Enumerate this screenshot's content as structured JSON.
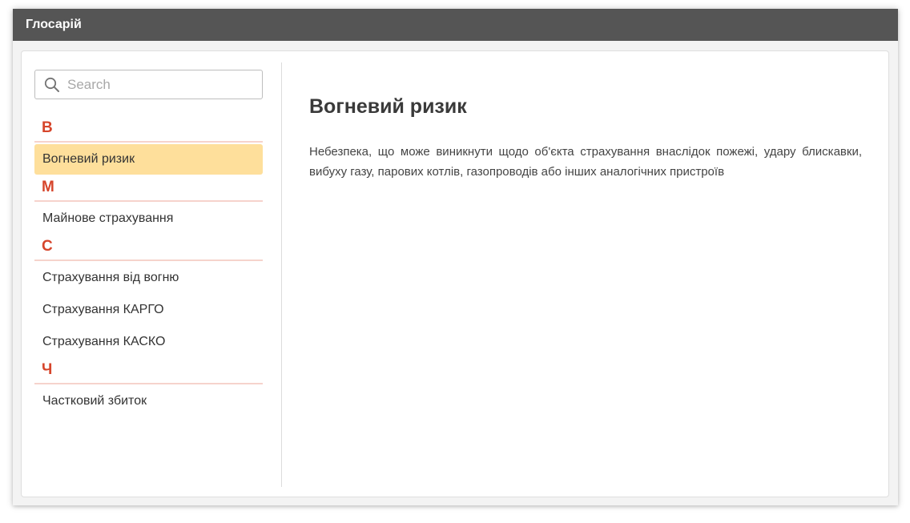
{
  "window": {
    "title": "Глосарій"
  },
  "search": {
    "placeholder": "Search",
    "value": ""
  },
  "glossary": {
    "groups": [
      {
        "letter": "В",
        "items": [
          "Вогневий ризик"
        ]
      },
      {
        "letter": "М",
        "items": [
          "Майнове страхування"
        ]
      },
      {
        "letter": "С",
        "items": [
          "Страхування від вогню",
          "Страхування КАРГО",
          "Страхування КАСКО"
        ]
      },
      {
        "letter": "Ч",
        "items": [
          "Частковий збиток"
        ]
      }
    ],
    "selected": "Вогневий ризик"
  },
  "detail": {
    "title": "Вогневий ризик",
    "text": "Небезпека, що може виникнути щодо об'єкта страхування внаслідок пожежі, удару блискавки, вибуху газу, парових котлів, газопроводів або інших аналогічних пристроїв"
  },
  "colors": {
    "titlebar": "#555555",
    "letter": "#d6452b",
    "letter_underline": "#f6d3cc",
    "active_item": "#fedf9b"
  },
  "icons": {
    "search": "search-icon"
  }
}
